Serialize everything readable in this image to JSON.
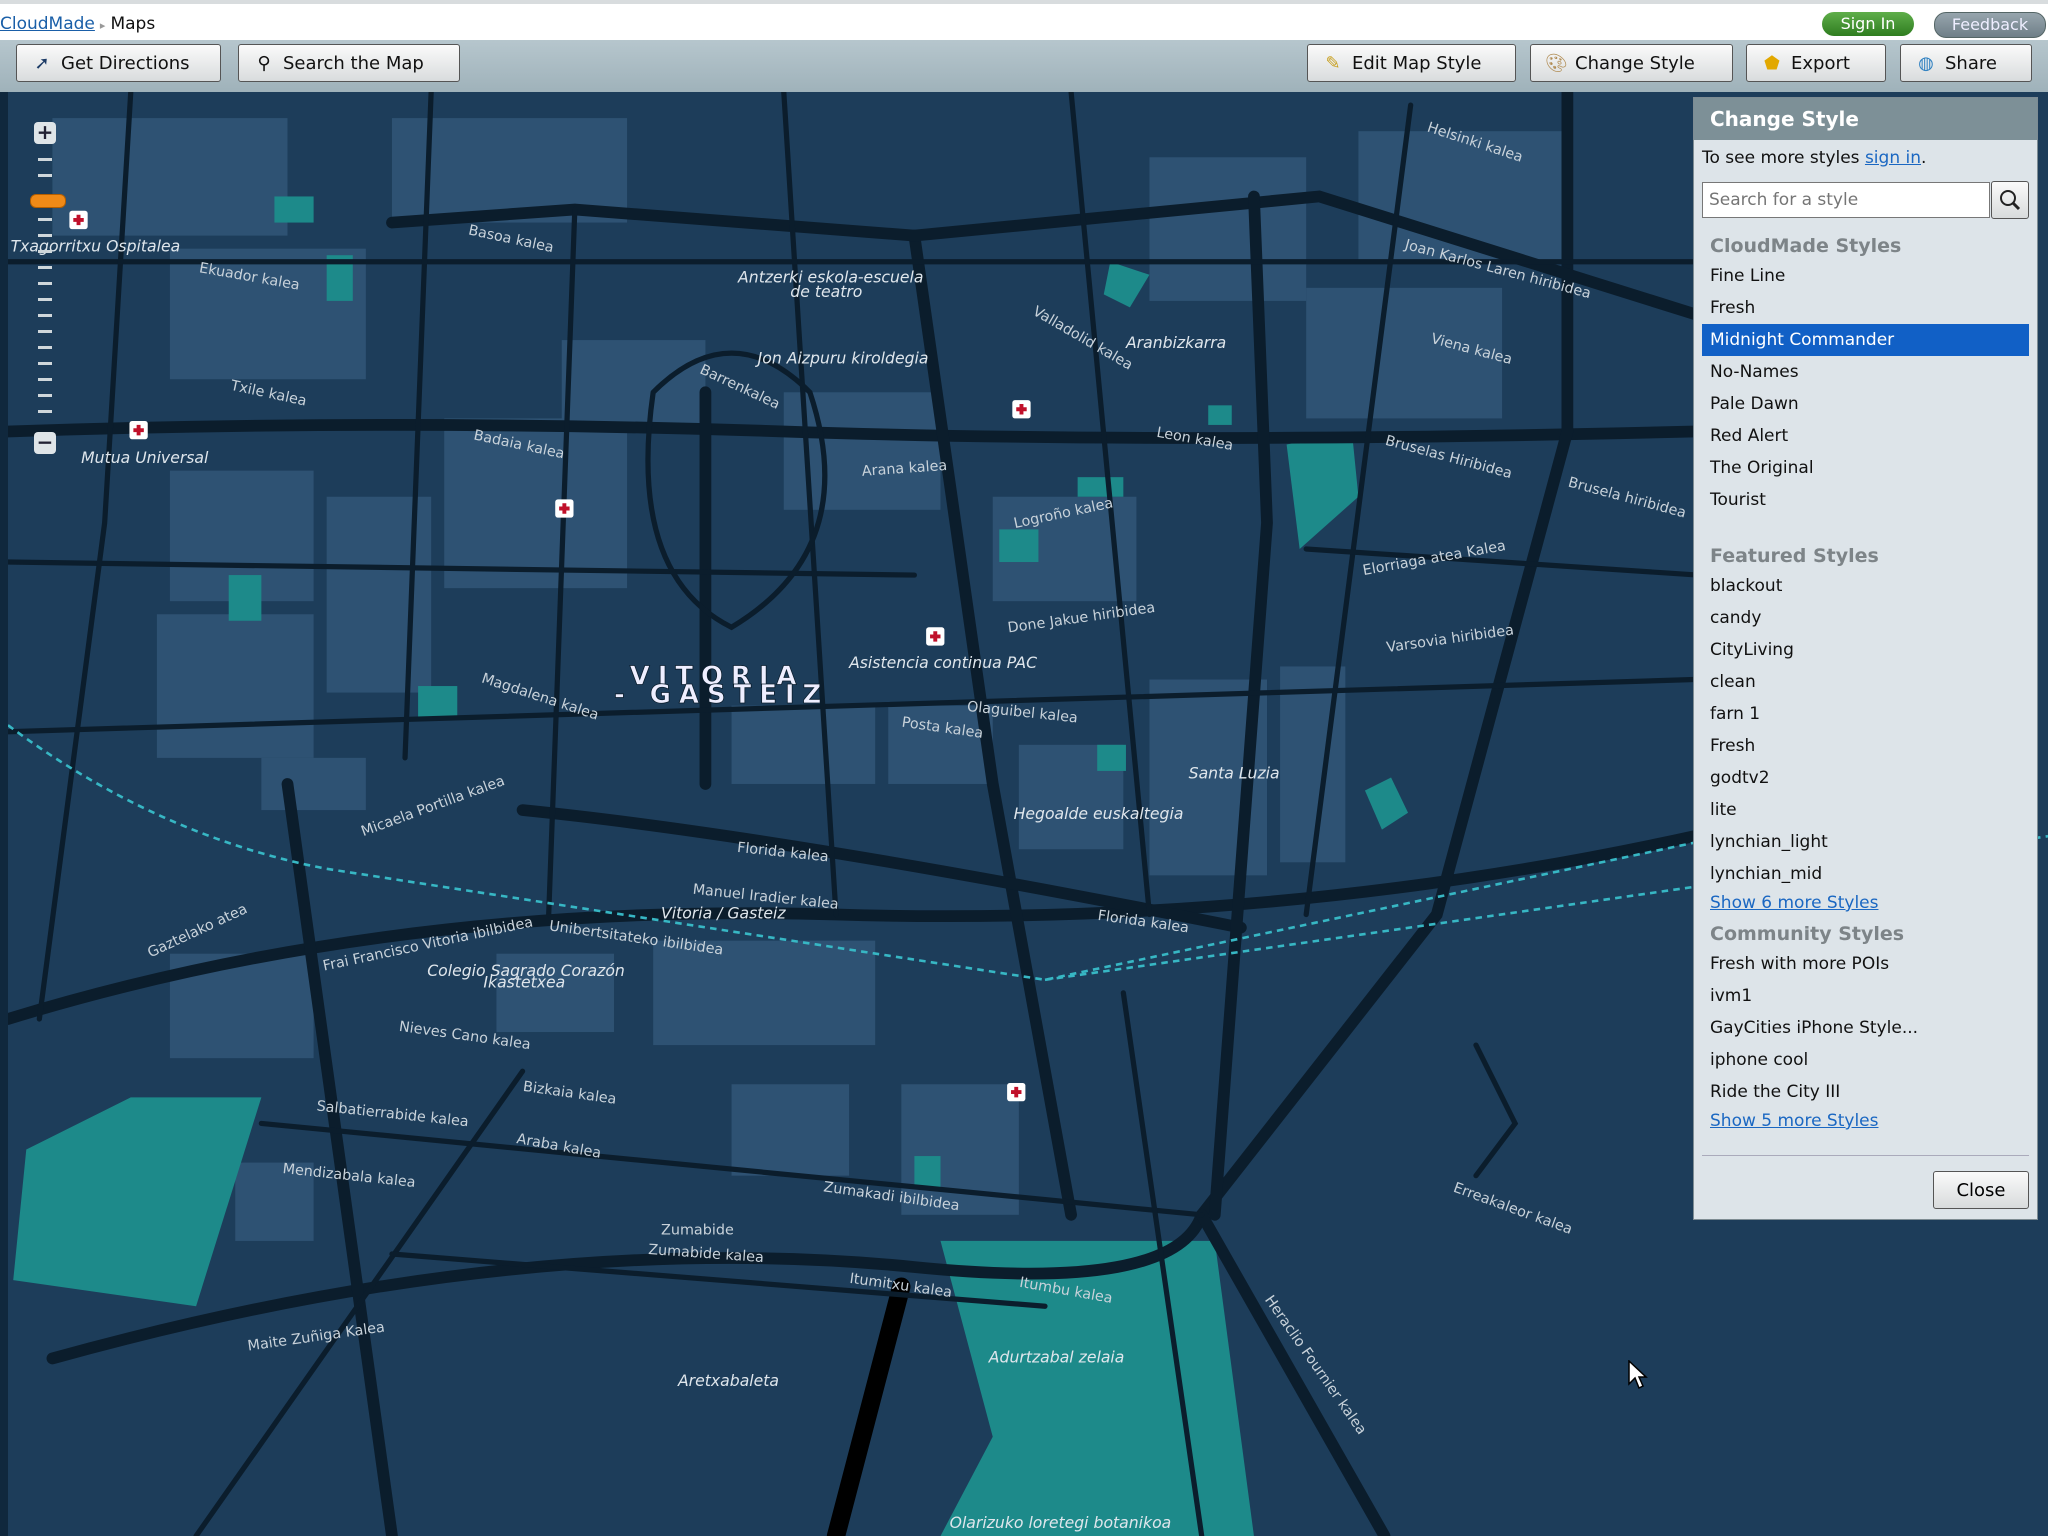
{
  "header": {
    "breadcrumb_home": "CloudMade",
    "breadcrumb_current": "Maps",
    "sign_in": "Sign In",
    "feedback": "Feedback"
  },
  "toolbar": {
    "get_directions": "Get Directions",
    "search_map": "Search the Map",
    "edit_style": "Edit Map Style",
    "change_style": "Change Style",
    "export": "Export",
    "share": "Share"
  },
  "panel": {
    "title": "Change Style",
    "intro": "To see more styles ",
    "sign_in_link": "sign in",
    "intro_end": ".",
    "search_placeholder": "Search for a style",
    "cloudmade": {
      "heading": "CloudMade Styles",
      "items": [
        "Fine Line",
        "Fresh",
        "Midnight Commander",
        "No-Names",
        "Pale Dawn",
        "Red Alert",
        "The Original",
        "Tourist"
      ],
      "selected": "Midnight Commander"
    },
    "featured": {
      "heading": "Featured Styles",
      "items": [
        "blackout",
        "candy",
        "CityLiving",
        "clean",
        "farn 1",
        "Fresh",
        "godtv2",
        "lite",
        "lynchian_light",
        "lynchian_mid"
      ],
      "more": "Show 6 more Styles"
    },
    "community": {
      "heading": "Community Styles",
      "items": [
        "Fresh with more POIs",
        "ivm1",
        "GayCities iPhone Style...",
        "iphone cool",
        "Ride the City III"
      ],
      "more": "Show 5 more Styles"
    },
    "close": "Close"
  },
  "map": {
    "city": [
      "VITORIA",
      "- GASTEIZ"
    ],
    "places": [
      "Asistencia continua PAC",
      "Santa Luzia",
      "Hegoalde euskaltegia",
      "Vitoria / Gasteiz",
      "Colegio Sagrado Corazón",
      "Ikastetxea",
      "Jon Aizpuru kiroldegia",
      "Antzerki eskola-escuela",
      "de teatro",
      "Aranbizkarra",
      "Mutua Universal",
      "Aretxabaleta",
      "Adurtzabal zelaia",
      "Olarizuko loretegi botanikoa",
      "Txagorritxu Ospitalea",
      "Zumabide"
    ],
    "streets": [
      "Florida kalea",
      "Manuel Iradier kalea",
      "Zumabide kalea",
      "Itumitxu kalea",
      "Maite Zuñiga Kalea",
      "Posta kalea",
      "Olaguibel kalea",
      "Leon kalea",
      "Bruselas Hiribidea",
      "Varsovia hiribidea",
      "Elorriaga atea Kalea",
      "Nieves Cano kalea",
      "Bizkaia kalea",
      "Araba kalea",
      "Zumakadi ibilbidea",
      "Done Jakue hiribidea",
      "Logroño kalea",
      "Arana kalea",
      "Badaia kalea",
      "Basoa kalea",
      "Ekuador kalea",
      "Txile kalea",
      "Mendizabala kalea",
      "Salbatierrabide kalea",
      "Frai Francisco Vitoria ibilbidea",
      "Unibertsitateko ibilbidea",
      "Micaela Portilla kalea",
      "Magdalena kalea",
      "Valladolid kalea",
      "Viena kalea",
      "Helsinki kalea",
      "Joan Karlos Laren hiribidea",
      "Brusela hiribidea",
      "Heraclio Fournier kalea",
      "Erreakaleor kalea",
      "Gaztelako atea",
      "Itumbu kalea",
      "Barrenkalea",
      "Florida kalea"
    ]
  },
  "colors": {
    "map_bg": "#1d3d5a",
    "road": "#0b1d2c",
    "block": "#2e5273",
    "park": "#1d8a8a",
    "selected": "#1160c6"
  }
}
